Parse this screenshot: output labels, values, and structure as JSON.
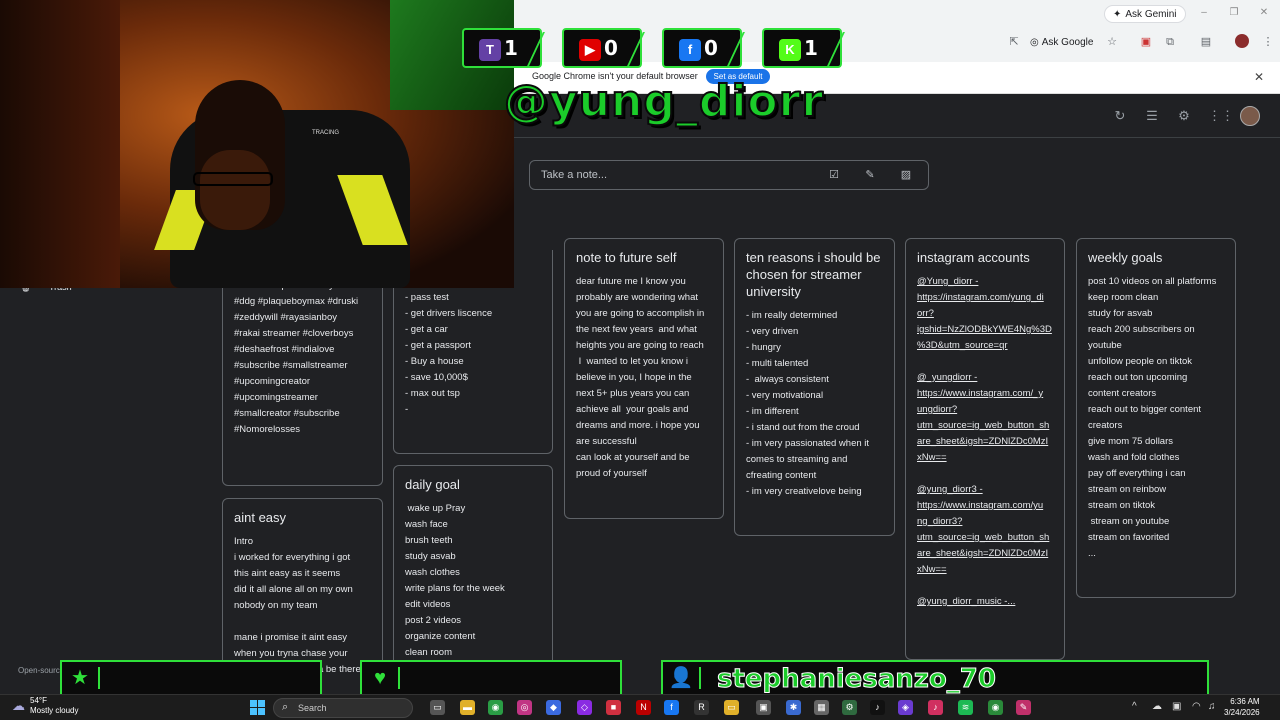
{
  "browser": {
    "ask_gemini": "Ask Gemini",
    "ask_google": "Ask Google",
    "infobar_text": "Google Chrome isn't your default browser",
    "set_default": "Set as default"
  },
  "keep": {
    "take_note_placeholder": "Take a note...",
    "sidebar_trash": "Trash",
    "open_source": "Open-source"
  },
  "notes": {
    "hashtags": {
      "lines": [
        "#streamersprofit #funnymemes",
        "#ddg #plaqueboymax #druski",
        "#zeddywill #rayasianboy",
        "#rakai streamer #cloverboys",
        "#deshaefrost #indialove",
        "#subscribe #smallstreamer",
        "#upcomingcreator",
        "#upcomingstreamer",
        "#smallcreator #subscribe",
        "#Nomorelosses"
      ]
    },
    "todo": {
      "lines": [
        "- pass test",
        "- get drivers liscence",
        "- get a car",
        "- get a passport",
        "- Buy a house",
        "- save 10,000$",
        "- max out tsp",
        "-"
      ]
    },
    "aint_easy": {
      "title": "aint easy",
      "lines": [
        "Intro",
        "i worked for everything i got",
        "this aint easy as it seems",
        "did it all alone all on my own",
        "nobody on my team",
        "",
        "mane i promise it aint easy",
        "when you tryna chase your",
        "dreams but you gotta be there for"
      ]
    },
    "daily_goal": {
      "title": "daily goal",
      "lines": [
        " wake up Pray",
        "wash face",
        "brush teeth",
        "study asvab",
        "wash clothes",
        "write plans for the week",
        "edit videos",
        "post 2 videos",
        "organize content",
        "clean room"
      ]
    },
    "future_self": {
      "title": "note to future self",
      "lines": [
        "dear future me I know you",
        "probably are wondering what",
        "you are going to accomplish in",
        "the next few years  and what",
        "heights you are going to reach",
        " I  wanted to let you know i",
        "believe in you, I hope in the",
        "next 5+ plus years you can",
        "achieve all  your goals and",
        "dreams and more. i hope you",
        "are successful",
        "can look at yourself and be",
        "proud of yourself"
      ]
    },
    "ten_reasons": {
      "title": "ten reasons i should be chosen for streamer university",
      "lines": [
        "- im really determined",
        "- very driven",
        "- hungry",
        "- multi talented",
        "-  always consistent",
        "- very motivational",
        "- im different",
        "- i stand out from the croud",
        "- im very passionated when it",
        "comes to streaming and",
        "cfreating content",
        "- im very creativelove being"
      ]
    },
    "instagram": {
      "title": "instagram accounts",
      "lines": [
        "@Yung_diorr -",
        "https://instagram.com/yung_di",
        "orr?",
        "igshid=NzZlODBkYWE4Ng%3D",
        "%3D&utm_source=qr",
        "",
        "@_yungdiorr -",
        "https://www.instagram.com/_y",
        "ungdiorr?",
        "utm_source=ig_web_button_sh",
        "are_sheet&igsh=ZDNlZDc0MzI",
        "xNw==",
        "",
        "@yung_diorr3 -",
        "https://www.instagram.com/yu",
        "ng_diorr3?",
        "utm_source=ig_web_button_sh",
        "are_sheet&igsh=ZDNlZDc0MzI",
        "xNw==",
        "",
        "@yung_diorr_music -..."
      ]
    },
    "weekly": {
      "title": "weekly goals",
      "lines": [
        "post 10 videos on all platforms",
        "keep room clean",
        "study for asvab",
        "reach 200 subscribers on",
        "youtube",
        "unfollow people on tiktok",
        "reach out ton upcoming",
        "content creators",
        "reach out to bigger content",
        "creators",
        "give mom 75 dollars",
        "wash and fold clothes",
        "pay off everything i can",
        "stream on reinbow",
        "stream on tiktok",
        " stream on youtube",
        "stream on favorited",
        "..."
      ]
    }
  },
  "overlay": {
    "handle": "@yung_diorr",
    "counters": [
      {
        "platform": "twitch-icon",
        "value": "1",
        "color": "#6441a5",
        "glyph": "T"
      },
      {
        "platform": "youtube-icon",
        "value": "0",
        "color": "#e00000",
        "glyph": "▶"
      },
      {
        "platform": "facebook-icon",
        "value": "0",
        "color": "#1877f2",
        "glyph": "f"
      },
      {
        "platform": "kick-icon",
        "value": "1",
        "color": "#53fc18",
        "glyph": "K"
      }
    ],
    "follower_name": "stephaniesanzo_70",
    "cam_label": "TRACING"
  },
  "taskbar": {
    "temp": "54°F",
    "weather": "Mostly cloudy",
    "search": "Search",
    "time": "6:36 AM",
    "date": "3/24/2026"
  }
}
